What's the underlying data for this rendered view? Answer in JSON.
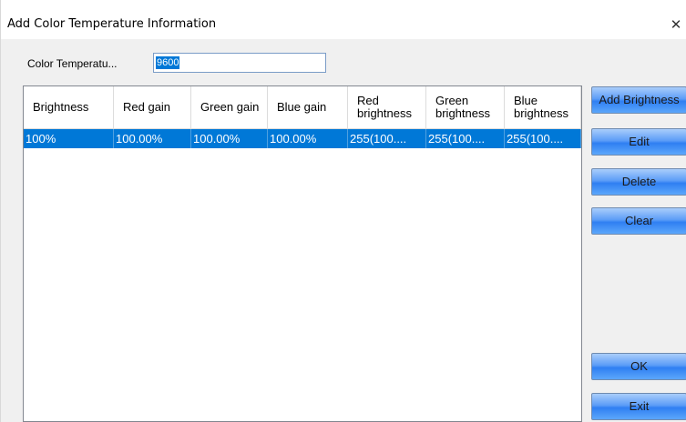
{
  "window": {
    "title": "Add Color Temperature Information",
    "close_glyph": "✕"
  },
  "form": {
    "color_temperature_label": "Color Temperatu...",
    "color_temperature_value": "9600"
  },
  "table": {
    "columns": [
      "Brightness",
      "Red gain",
      "Green gain",
      "Blue gain",
      "Red brightness",
      "Green brightness",
      "Blue brightness"
    ],
    "rows": [
      [
        "100%",
        "100.00%",
        "100.00%",
        "100.00%",
        "255(100....",
        "255(100....",
        "255(100...."
      ]
    ],
    "selected_row_color": "#0078d7"
  },
  "buttons": {
    "add_brightness": "Add Brightness",
    "edit": "Edit",
    "delete": "Delete",
    "clear": "Clear",
    "ok": "OK",
    "exit": "Exit"
  }
}
